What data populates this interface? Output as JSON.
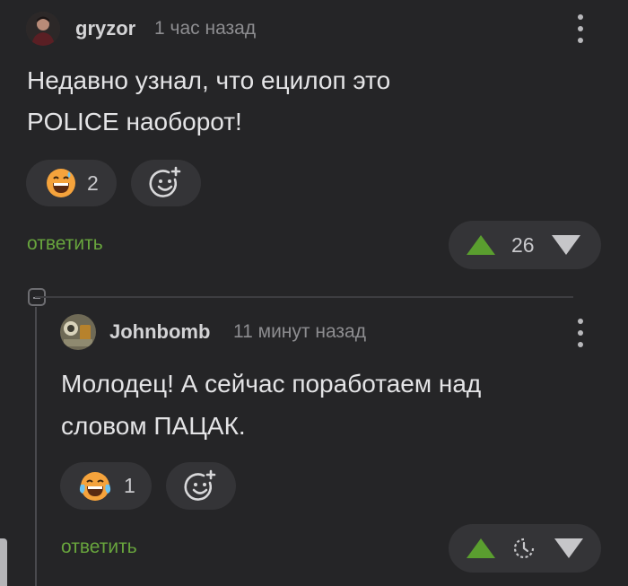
{
  "comment1": {
    "author": "gryzor",
    "time": "1 час назад",
    "text_line1": "Недавно узнал, что ецилоп это",
    "text_line2": "POLICE наоборот!",
    "reaction_count": "2",
    "reply_label": "ответить",
    "rating": "26"
  },
  "comment2": {
    "author": "Johnbomb",
    "time": "11 минут назад",
    "text_line1": "Молодец! А сейчас поработаем над",
    "text_line2": "словом ПАЦАК.",
    "reaction_count": "1",
    "reply_label": "ответить"
  },
  "colors": {
    "background": "#252527",
    "upvote": "#5a9e2f",
    "reply_link": "#68a53d",
    "pill": "#343437"
  }
}
